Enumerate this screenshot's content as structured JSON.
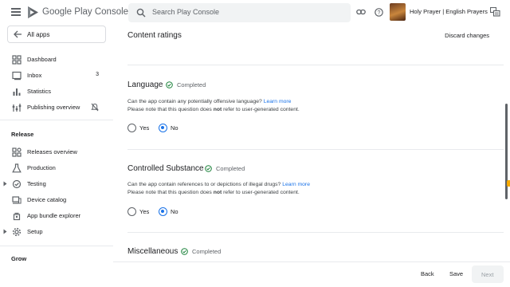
{
  "header": {
    "brand": "Google Play Console",
    "search_placeholder": "Search Play Console",
    "app_name": "Holy Prayer | English Prayers"
  },
  "sidebar": {
    "all_apps_label": "All apps",
    "items": [
      {
        "label": "Dashboard",
        "icon": "dashboard-icon"
      },
      {
        "label": "Inbox",
        "icon": "inbox-icon",
        "count": "3"
      },
      {
        "label": "Statistics",
        "icon": "statistics-icon"
      },
      {
        "label": "Publishing overview",
        "icon": "publishing-icon"
      }
    ],
    "release_title": "Release",
    "release_items": [
      {
        "label": "Releases overview",
        "icon": "releases-icon"
      },
      {
        "label": "Production",
        "icon": "production-icon"
      },
      {
        "label": "Testing",
        "icon": "testing-icon",
        "expandable": true
      },
      {
        "label": "Device catalog",
        "icon": "device-icon"
      },
      {
        "label": "App bundle explorer",
        "icon": "bundle-icon"
      },
      {
        "label": "Setup",
        "icon": "setup-icon",
        "expandable": true
      }
    ],
    "grow_title": "Grow"
  },
  "main": {
    "title": "Content ratings",
    "discard_label": "Discard changes",
    "sections": [
      {
        "heading": "Language",
        "status": "Completed",
        "question": "Can the app contain any potentially offensive language?",
        "learn_more": "Learn more",
        "note_pre": "Please note that this question does ",
        "note_bold": "not",
        "note_post": " refer to user-generated content.",
        "yes": "Yes",
        "no": "No",
        "selected": "No"
      },
      {
        "heading": "Controlled Substance",
        "status": "Completed",
        "question": "Can the app contain references to or depictions of illegal drugs?",
        "learn_more": "Learn more",
        "note_pre": "Please note that this question does ",
        "note_bold": "not",
        "note_post": " refer to user-generated content.",
        "yes": "Yes",
        "no": "No",
        "selected": "No"
      },
      {
        "heading": "Miscellaneous",
        "status": "Completed"
      }
    ]
  },
  "footer": {
    "back": "Back",
    "save": "Save",
    "next": "Next"
  },
  "colors": {
    "accent": "#1a73e8",
    "success": "#188038",
    "muted": "#5f6368"
  }
}
